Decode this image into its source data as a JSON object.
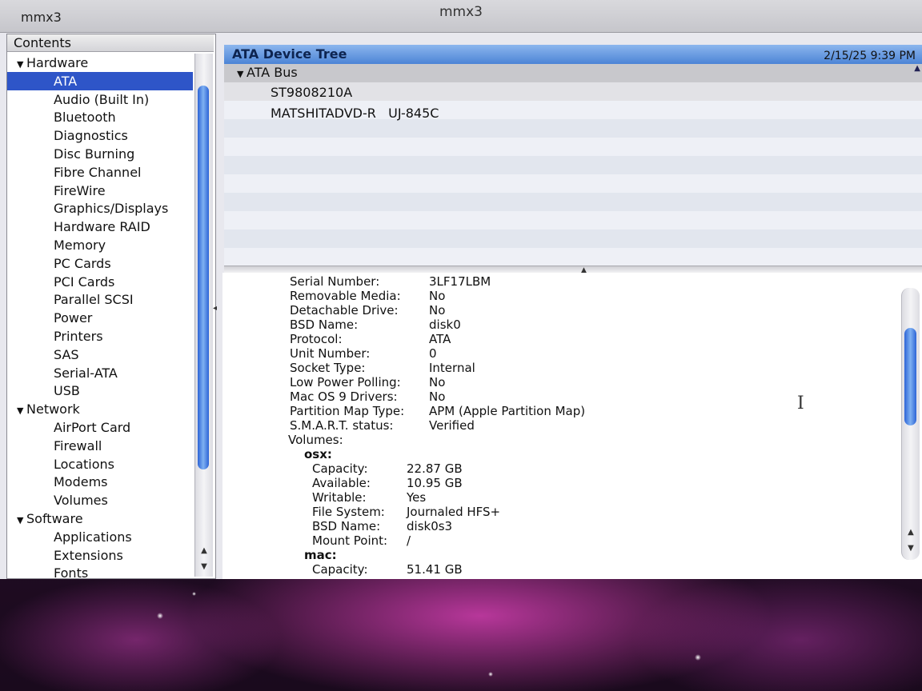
{
  "window": {
    "title": "mmx3",
    "title_left": "mmx3"
  },
  "sidebar": {
    "header": "Contents",
    "items": [
      {
        "label": "Hardware",
        "type": "section"
      },
      {
        "label": "ATA",
        "type": "child",
        "selected": true
      },
      {
        "label": "Audio (Built In)",
        "type": "child"
      },
      {
        "label": "Bluetooth",
        "type": "child"
      },
      {
        "label": "Diagnostics",
        "type": "child"
      },
      {
        "label": "Disc Burning",
        "type": "child"
      },
      {
        "label": "Fibre Channel",
        "type": "child"
      },
      {
        "label": "FireWire",
        "type": "child"
      },
      {
        "label": "Graphics/Displays",
        "type": "child"
      },
      {
        "label": "Hardware RAID",
        "type": "child"
      },
      {
        "label": "Memory",
        "type": "child"
      },
      {
        "label": "PC Cards",
        "type": "child"
      },
      {
        "label": "PCI Cards",
        "type": "child"
      },
      {
        "label": "Parallel SCSI",
        "type": "child"
      },
      {
        "label": "Power",
        "type": "child"
      },
      {
        "label": "Printers",
        "type": "child"
      },
      {
        "label": "SAS",
        "type": "child"
      },
      {
        "label": "Serial-ATA",
        "type": "child"
      },
      {
        "label": "USB",
        "type": "child"
      },
      {
        "label": "Network",
        "type": "section"
      },
      {
        "label": "AirPort Card",
        "type": "child"
      },
      {
        "label": "Firewall",
        "type": "child"
      },
      {
        "label": "Locations",
        "type": "child"
      },
      {
        "label": "Modems",
        "type": "child"
      },
      {
        "label": "Volumes",
        "type": "child"
      },
      {
        "label": "Software",
        "type": "section"
      },
      {
        "label": "Applications",
        "type": "child"
      },
      {
        "label": "Extensions",
        "type": "child"
      },
      {
        "label": "Fonts",
        "type": "child"
      }
    ]
  },
  "main": {
    "header_title": "ATA Device Tree",
    "timestamp": "2/15/25 9:39 PM",
    "tree": {
      "bus": "ATA Bus",
      "devices": [
        "ST9808210A",
        "MATSHITADVD-R   UJ-845C"
      ]
    },
    "details": {
      "fields": [
        {
          "label": "Serial Number:",
          "value": "3LF17LBM"
        },
        {
          "label": "Removable Media:",
          "value": "No"
        },
        {
          "label": "Detachable Drive:",
          "value": "No"
        },
        {
          "label": "BSD Name:",
          "value": "disk0"
        },
        {
          "label": "Protocol:",
          "value": "ATA"
        },
        {
          "label": "Unit Number:",
          "value": "0"
        },
        {
          "label": "Socket Type:",
          "value": "Internal"
        },
        {
          "label": "Low Power Polling:",
          "value": "No"
        },
        {
          "label": "Mac OS 9 Drivers:",
          "value": "No"
        },
        {
          "label": "Partition Map Type:",
          "value": "APM (Apple Partition Map)"
        },
        {
          "label": "S.M.A.R.T. status:",
          "value": "Verified"
        }
      ],
      "volumes_label": "Volumes:",
      "volumes": [
        {
          "name": "osx:",
          "fields": [
            {
              "label": "Capacity:",
              "value": "22.87 GB"
            },
            {
              "label": "Available:",
              "value": "10.95 GB"
            },
            {
              "label": "Writable:",
              "value": "Yes"
            },
            {
              "label": "File System:",
              "value": "Journaled HFS+"
            },
            {
              "label": "BSD Name:",
              "value": "disk0s3"
            },
            {
              "label": "Mount Point:",
              "value": "/"
            }
          ]
        },
        {
          "name": "mac:",
          "fields": [
            {
              "label": "Capacity:",
              "value": "51.41 GB"
            }
          ]
        }
      ]
    }
  },
  "colors": {
    "selection": "#2e55c8",
    "header_blue": "#4c84d6",
    "scroll_thumb": "#2d64d6"
  }
}
